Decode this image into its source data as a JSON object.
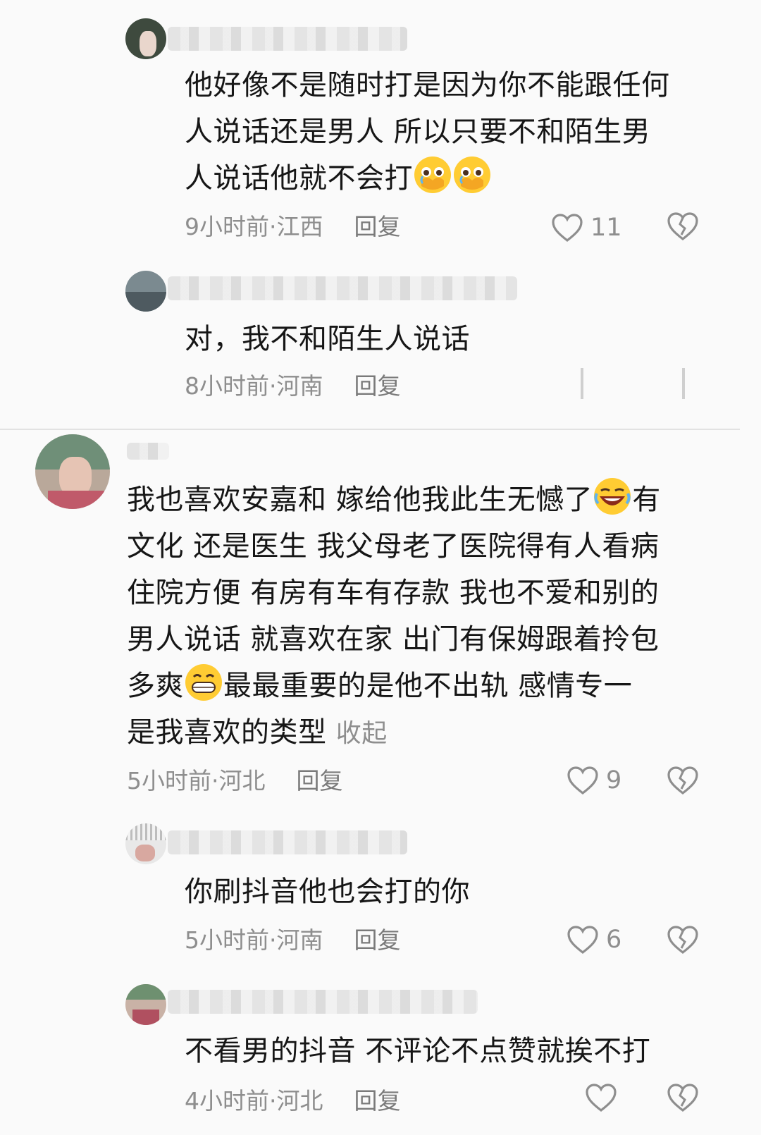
{
  "comments": [
    {
      "lines": [
        "他好像不是随时打是因为你不能跟任何",
        "人说话还是男人 所以只要不和陌生男",
        "人说话他就不会打"
      ],
      "time": "9小时前",
      "region": "江西",
      "reply": "回复",
      "likes": "11"
    },
    {
      "lines": [
        "对，我不和陌生人说话"
      ],
      "time": "8小时前",
      "region": "河南",
      "reply": "回复"
    },
    {
      "lines": [
        "我也喜欢安嘉和 嫁给他我此生无憾了",
        "有",
        "文化 还是医生 我父母老了医院得有人看病",
        "住院方便  有房有车有存款 我也不爱和别的",
        "男人说话 就喜欢在家 出门有保姆跟着拎包",
        "多爽",
        "最最重要的是他不出轨 感情专一",
        "是我喜欢的类型"
      ],
      "collapse": "收起",
      "time": "5小时前",
      "region": "河北",
      "reply": "回复",
      "likes": "9"
    },
    {
      "lines": [
        "你刷抖音他也会打的你"
      ],
      "time": "5小时前",
      "region": "河南",
      "reply": "回复",
      "likes": "6"
    },
    {
      "lines": [
        "不看男的抖音 不评论不点赞就挨不打"
      ],
      "time": "4小时前",
      "region": "河北",
      "reply": "回复"
    }
  ],
  "separator": " · ",
  "icons": {
    "like": "heart-outline-icon",
    "dislike": "broken-heart-icon",
    "crying_emoji": "pleading-crying-emoji",
    "laughing_emoji": "rolling-laughing-emoji",
    "grin_emoji": "grinning-teeth-emoji"
  },
  "colors": {
    "background": "#fafafa",
    "text": "#161616",
    "meta": "#8e8e8e"
  }
}
